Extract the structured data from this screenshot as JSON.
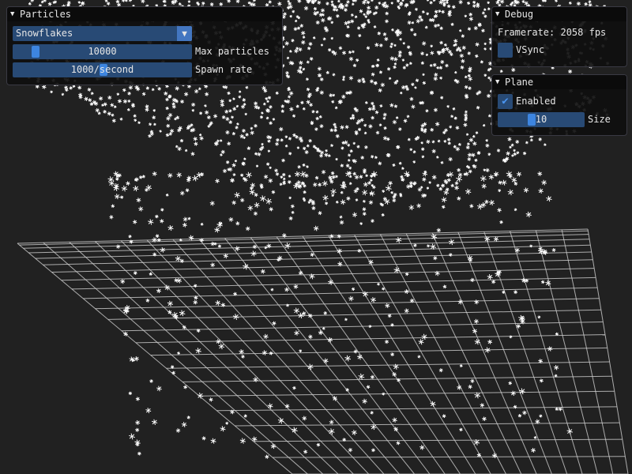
{
  "particles_window": {
    "title": "Particles",
    "particle_type": "Snowflakes",
    "max_particles": {
      "value": "10000",
      "label": "Max particles",
      "fraction": 0.1
    },
    "spawn_rate": {
      "value": "1000/second",
      "label": "Spawn rate",
      "fraction": 0.5
    }
  },
  "debug_window": {
    "title": "Debug",
    "framerate_text": "Framerate: 2058 fps",
    "vsync_label": "VSync",
    "vsync_checked": false
  },
  "plane_window": {
    "title": "Plane",
    "enabled_label": "Enabled",
    "enabled_checked": true,
    "size": {
      "value": "10",
      "label": "Size",
      "fraction": 0.4
    }
  },
  "icons": {
    "collapse": "triangle-down-icon",
    "combo_arrow": "triangle-down-icon",
    "check": "checkmark-icon"
  },
  "colors": {
    "background": "#212121",
    "frame": "#284a75",
    "grab": "#3d85e0",
    "check": "#4a95f0",
    "grid": "#cfcfcf",
    "particle": "#ffffff"
  }
}
